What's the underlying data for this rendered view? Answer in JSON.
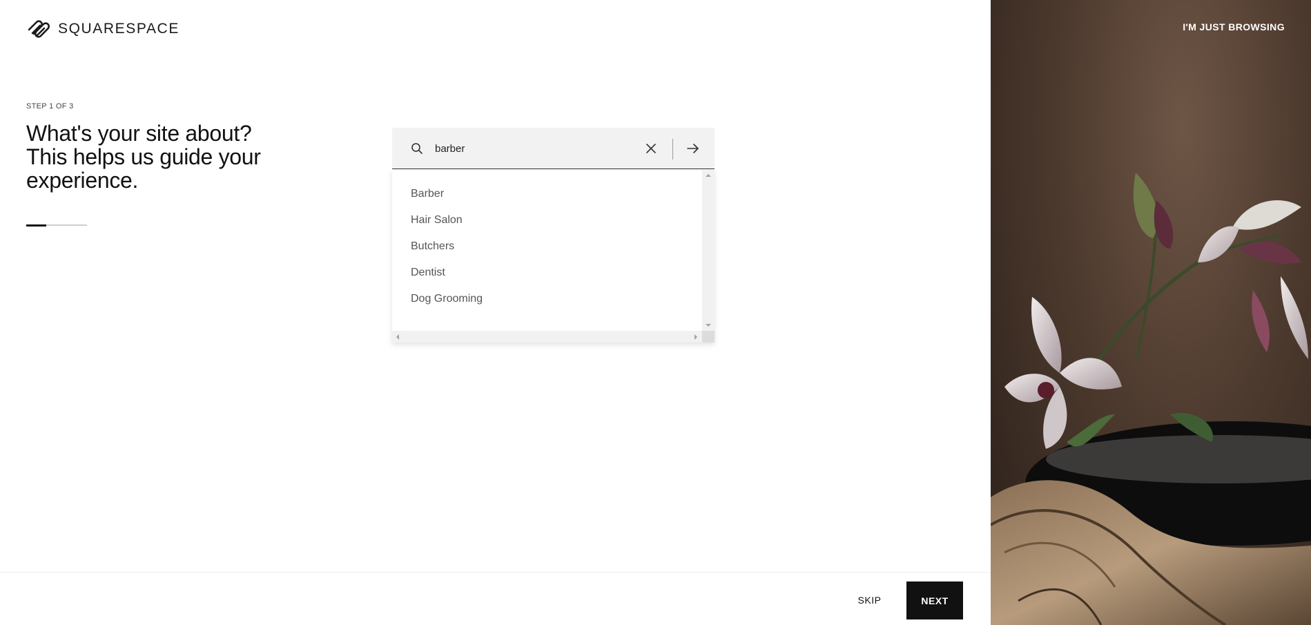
{
  "brand": {
    "name": "SQUARESPACE"
  },
  "step": {
    "label": "STEP 1 OF 3",
    "current": 1,
    "total": 3,
    "progress_fraction": 0.33
  },
  "headline": "What's your site about? This helps us guide your experience.",
  "search": {
    "value": "barber",
    "icon": "search-icon",
    "clear_icon": "close-icon",
    "submit_icon": "arrow-right-icon"
  },
  "suggestions": [
    "Barber",
    "Hair Salon",
    "Butchers",
    "Dentist",
    "Dog Grooming"
  ],
  "footer": {
    "skip_label": "SKIP",
    "next_label": "NEXT"
  },
  "right_panel": {
    "browse_label": "I'M JUST BROWSING"
  },
  "colors": {
    "accent": "#111111",
    "search_bg": "#f2f2f2",
    "suggestion_text": "#555555"
  }
}
